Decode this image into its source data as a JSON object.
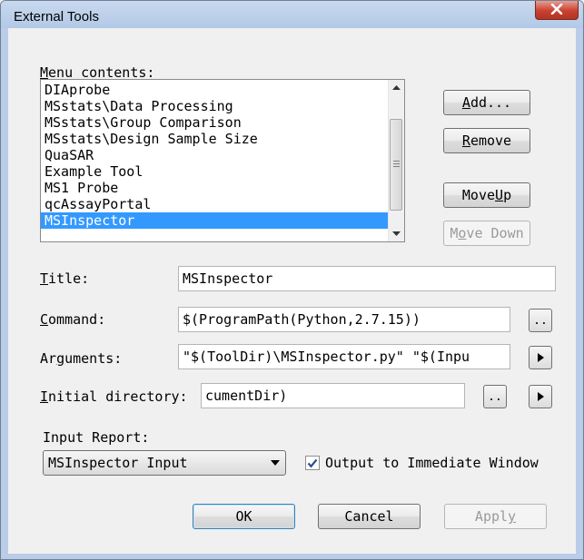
{
  "window": {
    "title": "External Tools"
  },
  "menu_contents": {
    "label_prefix": "",
    "label_underline": "M",
    "label_rest": "enu contents:",
    "items": [
      {
        "label": "DIAprobe",
        "selected": false
      },
      {
        "label": "MSstats\\Data Processing",
        "selected": false
      },
      {
        "label": "MSstats\\Group Comparison",
        "selected": false
      },
      {
        "label": "MSstats\\Design Sample Size",
        "selected": false
      },
      {
        "label": "QuaSAR",
        "selected": false
      },
      {
        "label": "Example Tool",
        "selected": false
      },
      {
        "label": "MS1 Probe",
        "selected": false
      },
      {
        "label": "qcAssayPortal",
        "selected": false
      },
      {
        "label": "MSInspector",
        "selected": true
      }
    ]
  },
  "buttons": {
    "add": {
      "pre": "",
      "u": "A",
      "post": "dd..."
    },
    "remove": {
      "pre": "",
      "u": "R",
      "post": "emove"
    },
    "move_up": {
      "pre": "Move ",
      "u": "U",
      "post": "p"
    },
    "move_down": {
      "pre": "M",
      "u": "o",
      "post": "ve Down"
    },
    "ok": "OK",
    "cancel": "Cancel",
    "apply": {
      "pre": "Appl",
      "u": "y",
      "post": ""
    }
  },
  "fields": {
    "title": {
      "pre": "",
      "u": "T",
      "post": "itle:",
      "value": "MSInspector"
    },
    "command": {
      "pre": "",
      "u": "C",
      "post": "ommand:",
      "value": "$(ProgramPath(Python,2.7.15))"
    },
    "arguments": {
      "pre": "Ar",
      "u": "g",
      "post": "uments:",
      "value": "\"$(ToolDir)\\MSInspector.py\" \"$(Inpu"
    },
    "initial_directory": {
      "pre": "",
      "u": "I",
      "post": "nitial directory:",
      "value": "cumentDir)"
    }
  },
  "input_report": {
    "label": "Input Report:",
    "selected": "MSInspector Input"
  },
  "output_checkbox": {
    "checked": true,
    "label": "Output to Immediate Window"
  },
  "small_buttons": {
    "browse_command": "..",
    "browse_directory": ".."
  }
}
